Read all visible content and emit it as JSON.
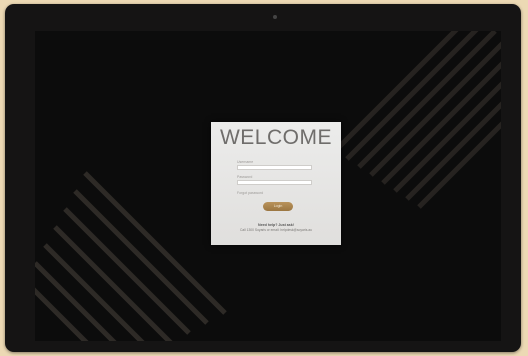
{
  "login": {
    "title": "WELCOME",
    "username_label": "Username",
    "username_value": "",
    "password_label": "Password",
    "password_value": "",
    "forgot_label": "Forgot password",
    "login_button": "Login",
    "help_title": "Need help? Just ask!",
    "help_text": "Call 1300 Soyaris or email: helpdesk@soyaris.au"
  },
  "colors": {
    "background": "#ecd9b4",
    "monitor_bezel": "#151414",
    "screen": "#0c0c0c",
    "card": "#e6e5e3",
    "accent_gold": "#a8844c"
  },
  "icons": {
    "camera": "webcam-dot"
  }
}
